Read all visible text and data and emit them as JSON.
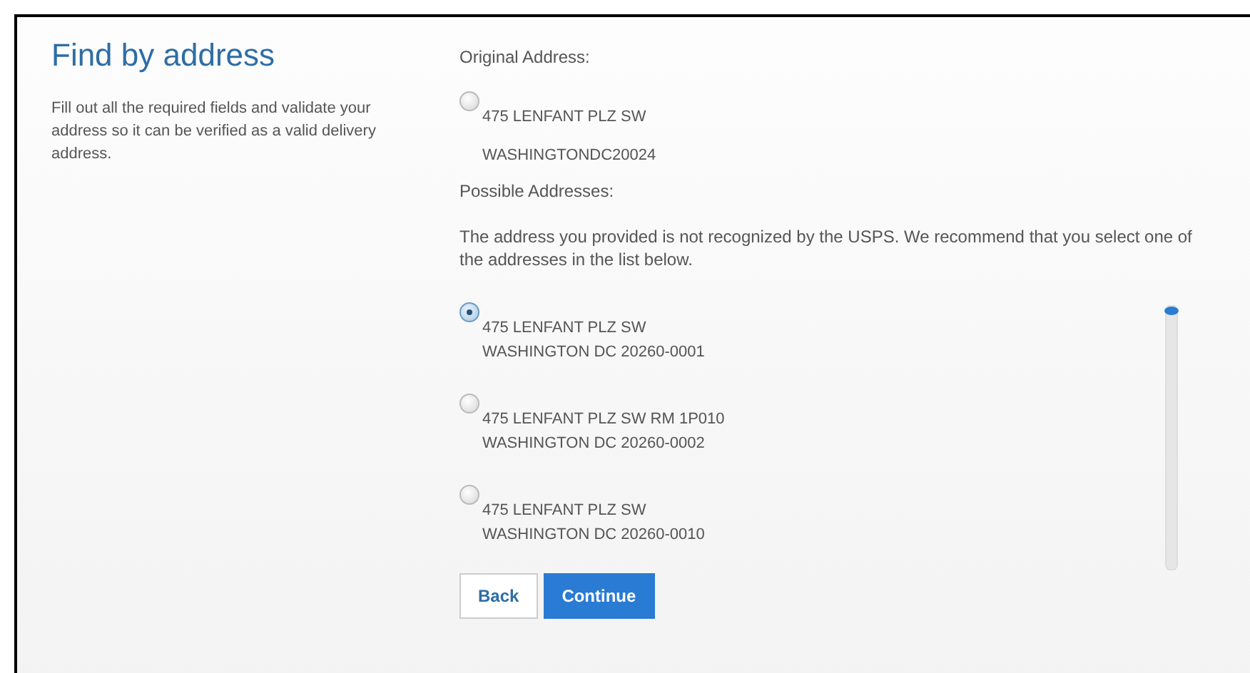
{
  "intro": {
    "title": "Find by address",
    "text": "Fill out all the required fields and validate your address so it can be verified as a valid delivery address."
  },
  "original": {
    "heading": "Original Address:",
    "selected": false,
    "line_1": "475 LENFANT PLZ SW",
    "line_2": "WASHINGTONDC20024"
  },
  "possible": {
    "heading": "Possible Addresses:",
    "message": "The address you provided is not recognized by the USPS. We recommend that you select one of the addresses in the list below.",
    "addresses": [
      {
        "line_1": "475 LENFANT PLZ SW",
        "line_2": "WASHINGTON DC 20260-0001",
        "selected": true
      },
      {
        "line_1": "475 LENFANT PLZ SW RM 1P010",
        "line_2": "WASHINGTON DC 20260-0002",
        "selected": false
      },
      {
        "line_1": "475 LENFANT PLZ SW",
        "line_2": "WASHINGTON DC 20260-0010",
        "selected": false
      }
    ]
  },
  "buttons": [
    {
      "label": "Back",
      "kind": "secondary"
    },
    {
      "label": "Continue",
      "kind": "primary"
    }
  ]
}
